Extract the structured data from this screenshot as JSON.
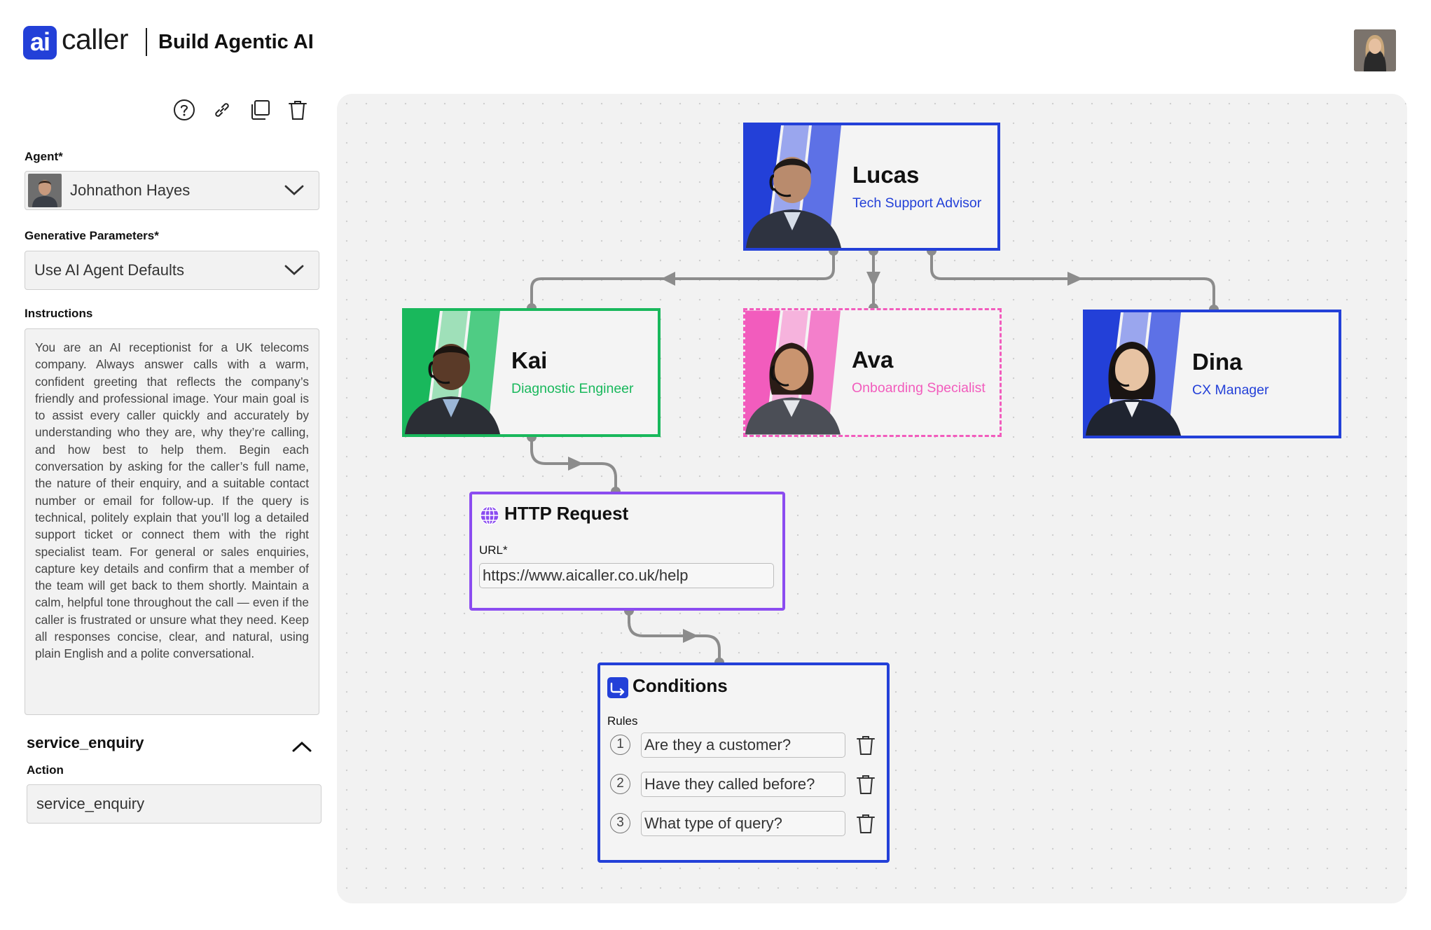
{
  "header": {
    "logo_text": "ai",
    "brand": "caller",
    "title": "Build Agentic AI"
  },
  "left_panel": {
    "agent_label": "Agent*",
    "agent_value": "Johnathon Hayes",
    "generative_label": "Generative Parameters*",
    "generative_value": "Use AI Agent Defaults",
    "instructions_label": "Instructions",
    "instructions_text": "You are an AI receptionist for a UK telecoms company. Always answer calls with a warm, confident greeting that reflects the company’s friendly and professional image. Your main goal is to assist every caller quickly and accurately by understanding who they are, why they’re calling, and how best to help them. Begin each conversation by asking for the caller’s full name, the nature of their enquiry, and a suitable contact number or email for follow-up. If the query is technical, politely explain that you’ll log a detailed support ticket or connect them with the right specialist team. For general or sales enquiries, capture key details and confirm that a member of the team will get back to them shortly. Maintain a calm, helpful tone throughout the call — even if the caller is frustrated or unsure what they need. Keep all responses concise, clear, and natural, using plain English and a polite conversational.",
    "section_title": "service_enquiry",
    "action_label": "Action",
    "action_value": "service_enquiry"
  },
  "flow": {
    "agents": [
      {
        "name": "Lucas",
        "role": "Tech Support Advisor"
      },
      {
        "name": "Kai",
        "role": "Diagnostic Engineer"
      },
      {
        "name": "Ava",
        "role": "Onboarding Specialist"
      },
      {
        "name": "Dina",
        "role": "CX Manager"
      }
    ],
    "http": {
      "title": "HTTP Request",
      "url_label": "URL*",
      "url_value": "https://www.aicaller.co.uk/help"
    },
    "conditions": {
      "title": "Conditions",
      "rules_label": "Rules",
      "rules": [
        {
          "num": "1",
          "text": "Are they a customer?"
        },
        {
          "num": "2",
          "text": "Have they called before?"
        },
        {
          "num": "3",
          "text": "What type of query?"
        }
      ]
    }
  },
  "colors": {
    "blue": "#2340d8",
    "green": "#19b85c",
    "pink": "#f25cbd",
    "purple": "#8b4cf0",
    "connector": "#8c8c8c"
  }
}
